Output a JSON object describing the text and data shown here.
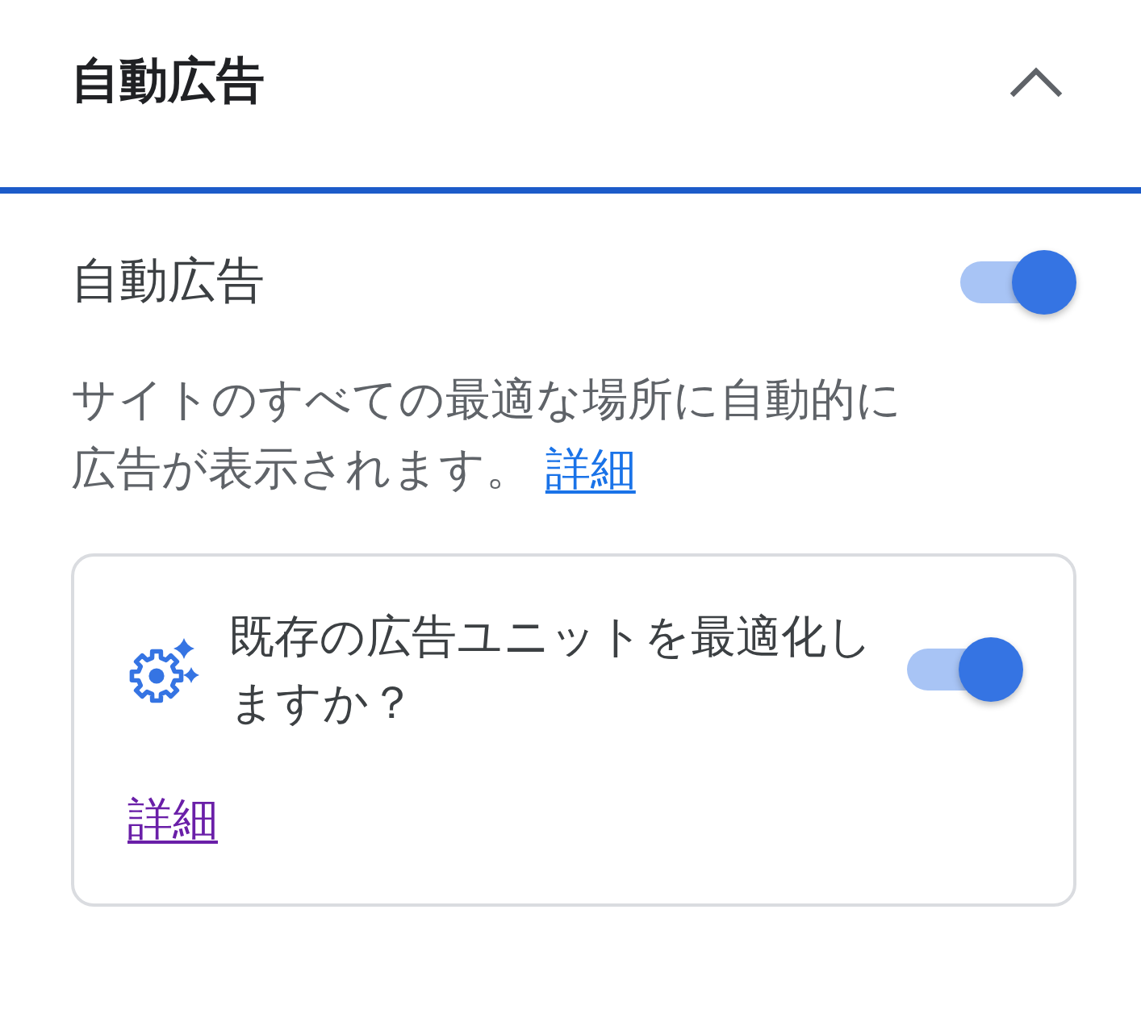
{
  "header": {
    "title": "自動広告",
    "expanded": true
  },
  "auto_ads": {
    "label": "自動広告",
    "on": true,
    "description": "サイトのすべての最適な場所に自動的に広告が表示されます。",
    "link": {
      "label": "詳細",
      "visited": false
    }
  },
  "optimize_card": {
    "question": "既存の広告ユニットを最適化しますか？",
    "on": true,
    "link": {
      "label": "詳細",
      "visited": true
    }
  }
}
